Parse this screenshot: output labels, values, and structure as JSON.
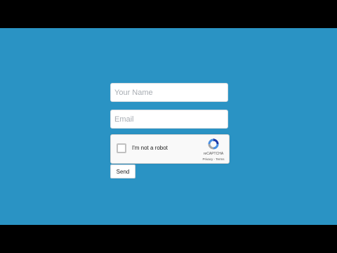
{
  "form": {
    "name_field": {
      "value": "",
      "placeholder": "Your Name"
    },
    "email_field": {
      "value": "",
      "placeholder": "Email"
    },
    "recaptcha": {
      "checked": false,
      "label": "I'm not a robot",
      "brand": "reCAPTCHA",
      "privacy_label": "Privacy",
      "separator": " - ",
      "terms_label": "Terms"
    },
    "send_label": "Send"
  },
  "colors": {
    "background": "#2a93c4",
    "letterbox": "#000000",
    "recaptcha_blue_dark": "#1c3aa9",
    "recaptcha_blue_light": "#4a90e2",
    "recaptcha_gray": "#a6a6a6"
  },
  "icons": {
    "recaptcha_logo": "recaptcha-logo-icon"
  }
}
